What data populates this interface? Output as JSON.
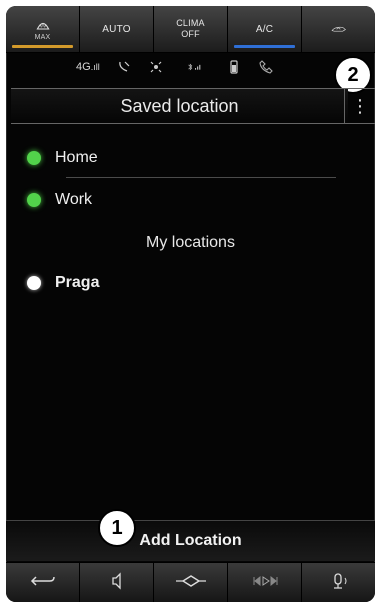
{
  "climate": {
    "buttons": [
      {
        "label": "",
        "sub": "MAX",
        "icon": "defrost-icon",
        "indicator": "#d39a2b"
      },
      {
        "label": "AUTO",
        "sub": "",
        "icon": "",
        "indicator": ""
      },
      {
        "label": "CLIMA",
        "sub": "OFF",
        "icon": "",
        "indicator": ""
      },
      {
        "label": "A/C",
        "sub": "",
        "icon": "",
        "indicator": "#2f6fd6"
      },
      {
        "label": "",
        "sub": "",
        "icon": "recirculation-icon",
        "indicator": ""
      }
    ]
  },
  "status": {
    "network": "4G",
    "callout_top": "2",
    "callout_bottom": "1"
  },
  "header": {
    "title": "Saved location",
    "more": "⋮"
  },
  "saved": [
    {
      "label": "Home",
      "color": "#52d34b"
    },
    {
      "label": "Work",
      "color": "#52d34b"
    }
  ],
  "my_locations": {
    "title": "My locations",
    "items": [
      {
        "label": "Praga",
        "color": "#ffffff"
      }
    ]
  },
  "footer": {
    "add_label": "Add Location"
  }
}
